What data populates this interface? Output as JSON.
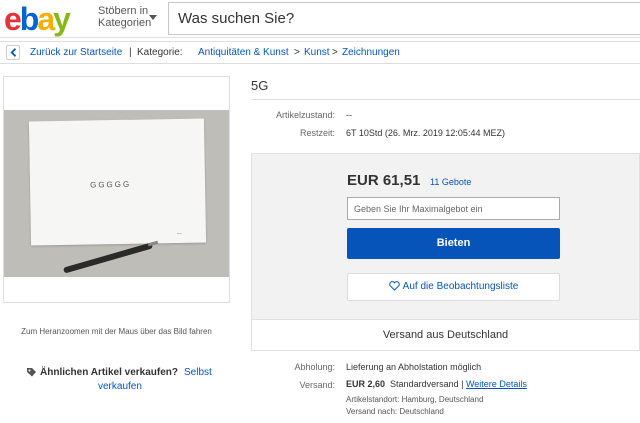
{
  "header": {
    "logo": {
      "letters": [
        "e",
        "b",
        "a",
        "y"
      ],
      "colors": [
        "#e53238",
        "#0064d2",
        "#f5af02",
        "#86b817"
      ]
    },
    "browse_line1": "Stöbern in",
    "browse_line2": "Kategorien",
    "search_placeholder": "Was suchen Sie?"
  },
  "breadcrumb": {
    "back_label": "Zurück zur Startseite",
    "separator": "|",
    "category_label": "Kategorie:",
    "items": [
      "Antiquitäten & Kunst",
      "Kunst",
      "Zeichnungen"
    ],
    "gt": ">"
  },
  "image_panel": {
    "paper_text": "GGGGG",
    "zoom_hint": "Zum Heranzoomen mit der Maus über das Bild fahren"
  },
  "sell_similar": {
    "question": "Ähnlichen Artikel verkaufen?",
    "link_part1": "Selbst",
    "link_part2": "verkaufen"
  },
  "listing": {
    "title": "5G",
    "condition_label": "Artikelzustand:",
    "condition_value": "--",
    "time_label": "Restzeit:",
    "time_value": "6T 10Std",
    "time_detail": "(26. Mrz. 2019  12:05:44 MEZ)"
  },
  "buy_box": {
    "price": "EUR 61,51",
    "bids": "11 Gebote",
    "max_bid_placeholder": "Geben Sie Ihr Maximalgebot ein",
    "bid_button": "Bieten",
    "watch_button": "Auf die Beobachtungsliste",
    "shipping_from": "Versand aus Deutschland"
  },
  "shipping": {
    "pickup_label": "Abholung:",
    "pickup_value": "Lieferung an Abholstation möglich",
    "ship_label": "Versand:",
    "ship_price": "EUR 2,60",
    "ship_method": "Standardversand",
    "ship_sep": "|",
    "more_details": "Weitere Details",
    "location": "Artikelstandort:  Hamburg, Deutschland",
    "ships_to": "Versand nach:  Deutschland"
  },
  "colors": {
    "link": "#0654ba",
    "accent_button": "#0654ba"
  }
}
